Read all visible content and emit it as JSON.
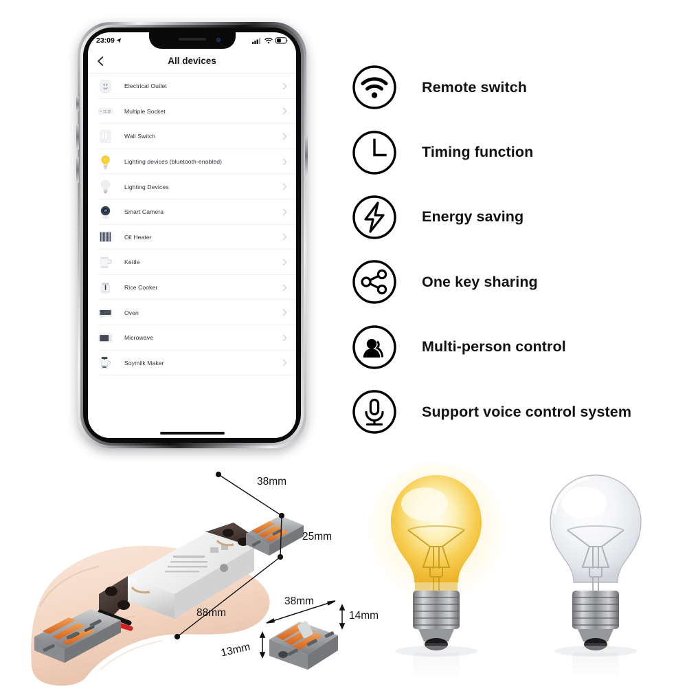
{
  "background": "#ffffff",
  "phone": {
    "status_bar": {
      "time": "23:09",
      "location_icon": "location-arrow-icon",
      "signal_icon": "cellular-signal-icon",
      "wifi_icon": "wifi-icon",
      "battery_icon": "battery-icon"
    },
    "nav": {
      "back_icon": "chevron-left-icon",
      "title": "All devices"
    },
    "devices": [
      {
        "label": "Electrical Outlet",
        "icon": "electrical-outlet-icon"
      },
      {
        "label": "Multiple Socket",
        "icon": "multiple-socket-icon"
      },
      {
        "label": "Wall Switch",
        "icon": "wall-switch-icon"
      },
      {
        "label": "Lighting devices (bluetooth-enabled)",
        "icon": "yellow-bulb-icon"
      },
      {
        "label": "Lighting Devices",
        "icon": "white-bulb-icon"
      },
      {
        "label": "Smart Camera",
        "icon": "smart-camera-icon"
      },
      {
        "label": "Oil Heater",
        "icon": "oil-heater-icon"
      },
      {
        "label": "Kettle",
        "icon": "kettle-icon"
      },
      {
        "label": "Rice Cooker",
        "icon": "rice-cooker-icon"
      },
      {
        "label": "Oven",
        "icon": "oven-icon"
      },
      {
        "label": "Microwave",
        "icon": "microwave-icon"
      },
      {
        "label": "Soymilk Maker",
        "icon": "soymilk-maker-icon"
      }
    ],
    "chevron_icon": "chevron-right-icon",
    "home_indicator": "home-indicator"
  },
  "features": [
    {
      "label": "Remote switch",
      "icon": "wifi-icon"
    },
    {
      "label": "Timing function",
      "icon": "clock-icon"
    },
    {
      "label": "Energy saving",
      "icon": "lightning-bolt-icon"
    },
    {
      "label": "One key sharing",
      "icon": "share-nodes-icon"
    },
    {
      "label": "Multi-person control",
      "icon": "people-icon"
    },
    {
      "label": "Support voice control system",
      "icon": "microphone-icon"
    }
  ],
  "product": {
    "main_unit_dimensions": [
      {
        "value": "38mm",
        "axis": "width"
      },
      {
        "value": "25mm",
        "axis": "height"
      },
      {
        "value": "88mm",
        "axis": "length"
      }
    ],
    "connector_dimensions": [
      {
        "value": "38mm",
        "axis": "length"
      },
      {
        "value": "14mm",
        "axis": "height"
      },
      {
        "value": "13mm",
        "axis": "depth"
      }
    ],
    "colors": {
      "body": "#e9e9e9",
      "terminal": "#4a3b33",
      "connector_body": "#9a9a9c",
      "connector_lever": "#e8762c",
      "wire_live": "#d22020",
      "wire_neutral": "#1a1a1a",
      "skin": "#f4d9c8"
    }
  },
  "bulbs": [
    {
      "name": "bulb-lit",
      "state": "on",
      "glass": "#f6c33c",
      "base": "#9a9a9a"
    },
    {
      "name": "bulb-unlit",
      "state": "off",
      "glass": "#e9ebed",
      "base": "#9a9a9a"
    }
  ]
}
